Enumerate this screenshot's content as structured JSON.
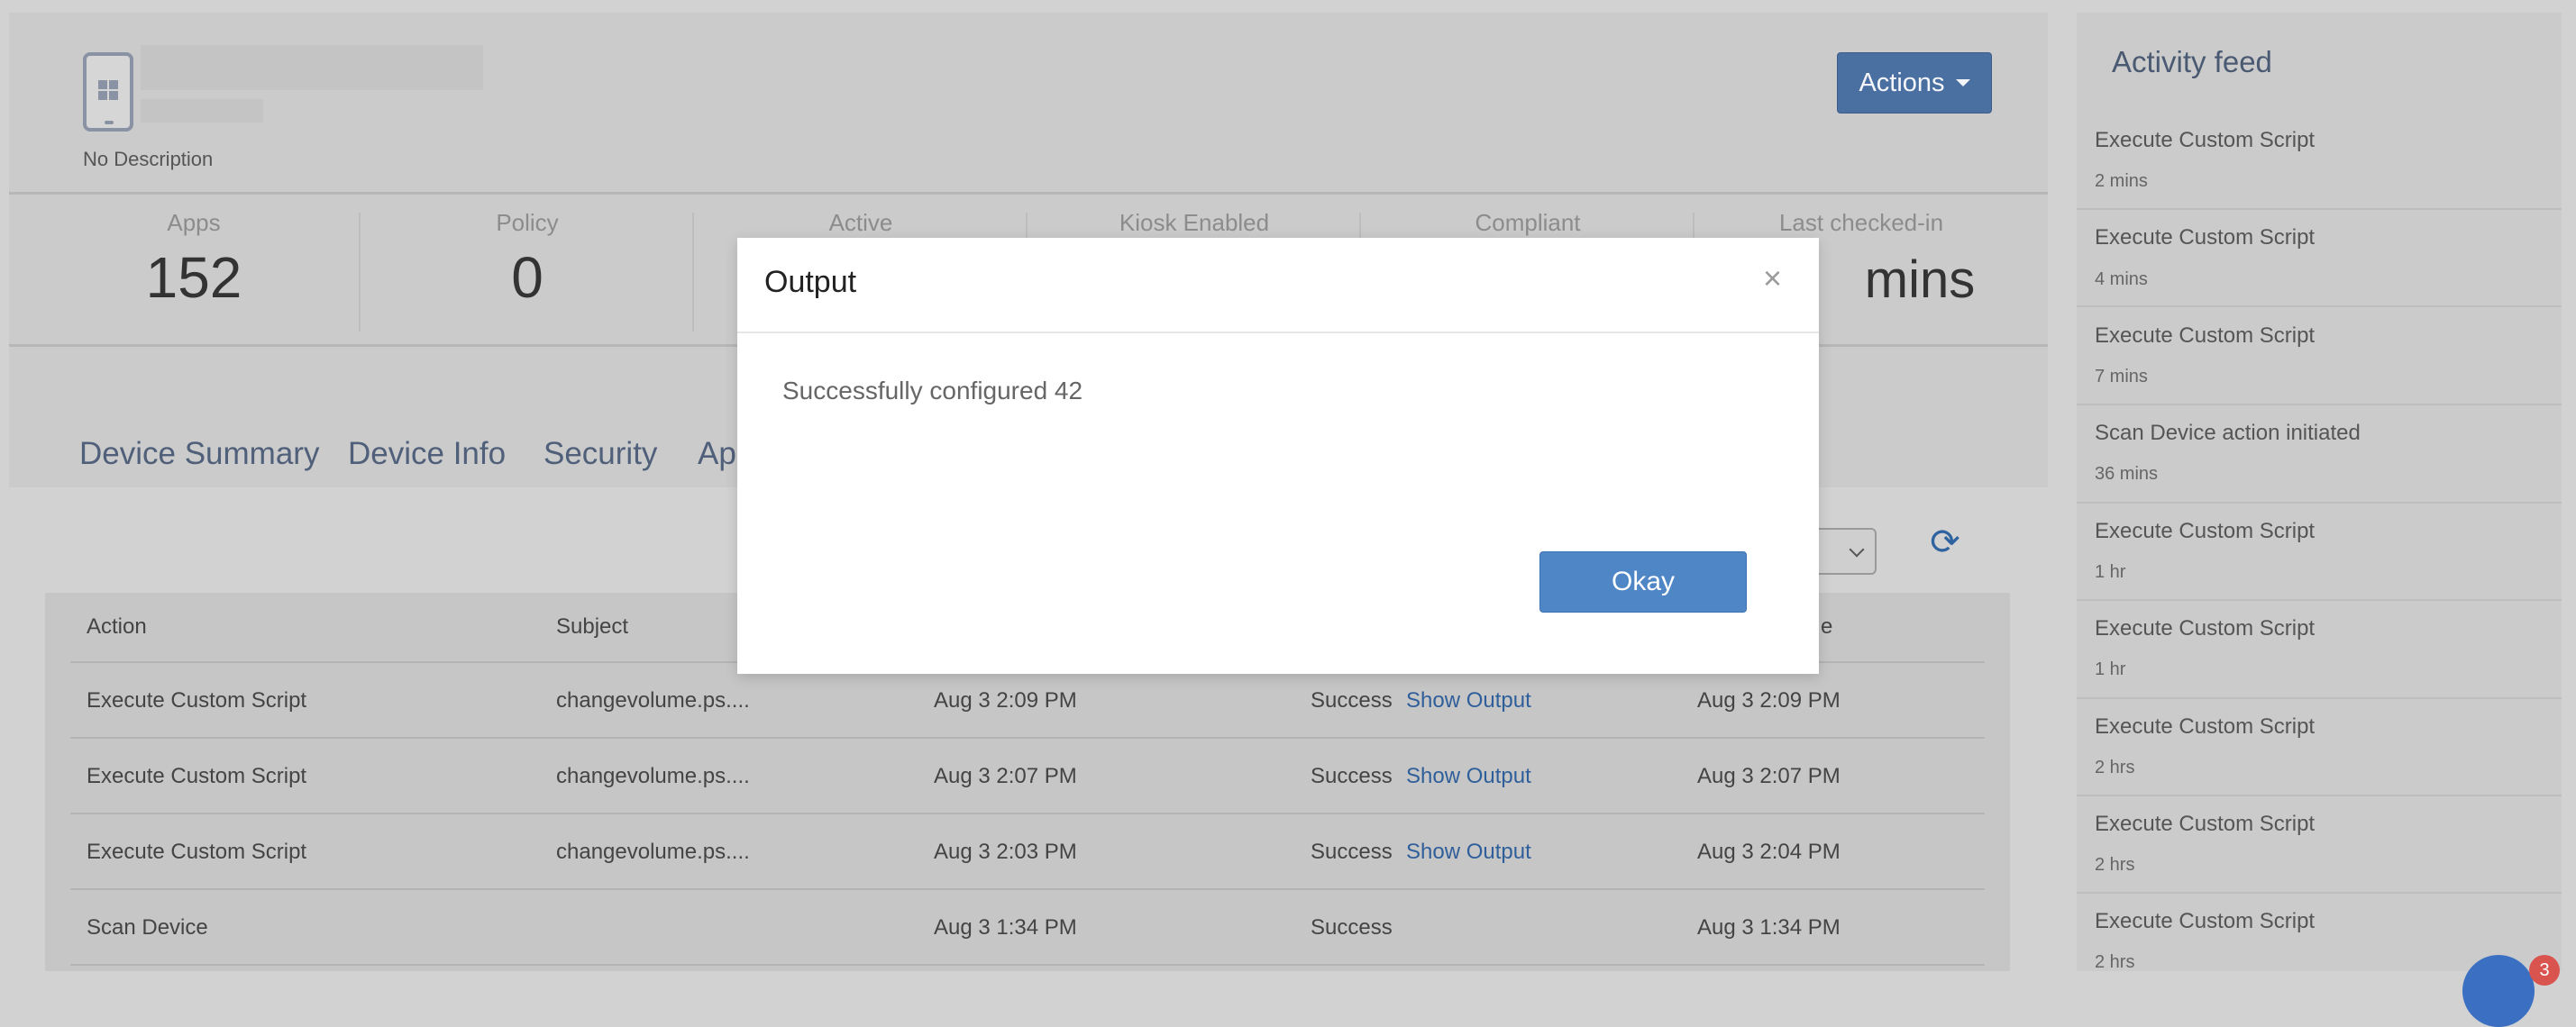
{
  "device": {
    "description": "No Description"
  },
  "header": {
    "actions_label": "Actions"
  },
  "stats": [
    {
      "label": "Apps",
      "value": "152"
    },
    {
      "label": "Policy",
      "value": "0"
    },
    {
      "label": "Active",
      "value": ""
    },
    {
      "label": "Kiosk Enabled",
      "value": ""
    },
    {
      "label": "Compliant",
      "value": ""
    },
    {
      "label": "Last checked-in",
      "value": "mins"
    }
  ],
  "tabs": [
    "Device Summary",
    "Device Info",
    "Security",
    "Ap"
  ],
  "table": {
    "headers": {
      "action": "Action",
      "subject": "Subject",
      "last_col": "e"
    },
    "rows": [
      {
        "action": "Execute Custom Script",
        "subject": "changevolume.ps....",
        "started": "Aug 3 2:09 PM",
        "status": "Success",
        "output": "Show Output",
        "completed": "Aug 3 2:09 PM"
      },
      {
        "action": "Execute Custom Script",
        "subject": "changevolume.ps....",
        "started": "Aug 3 2:07 PM",
        "status": "Success",
        "output": "Show Output",
        "completed": "Aug 3 2:07 PM"
      },
      {
        "action": "Execute Custom Script",
        "subject": "changevolume.ps....",
        "started": "Aug 3 2:03 PM",
        "status": "Success",
        "output": "Show Output",
        "completed": "Aug 3 2:04 PM"
      },
      {
        "action": "Scan Device",
        "subject": "",
        "started": "Aug 3 1:34 PM",
        "status": "Success",
        "output": "",
        "completed": "Aug 3 1:34 PM"
      }
    ]
  },
  "feed": {
    "title": "Activity feed",
    "items": [
      {
        "title": "Execute Custom Script",
        "time": "2 mins"
      },
      {
        "title": "Execute Custom Script",
        "time": "4 mins"
      },
      {
        "title": "Execute Custom Script",
        "time": "7 mins"
      },
      {
        "title": "Scan Device action initiated",
        "time": "36 mins"
      },
      {
        "title": "Execute Custom Script",
        "time": "1 hr"
      },
      {
        "title": "Execute Custom Script",
        "time": "1 hr"
      },
      {
        "title": "Execute Custom Script",
        "time": "2 hrs"
      },
      {
        "title": "Execute Custom Script",
        "time": "2 hrs"
      },
      {
        "title": "Execute Custom Script",
        "time": "2 hrs"
      }
    ]
  },
  "chat": {
    "badge": "3"
  },
  "modal": {
    "title": "Output",
    "close": "×",
    "message": "Successfully configured 42",
    "okay_label": "Okay"
  },
  "icons": {
    "refresh": "⟳"
  },
  "colors": {
    "accent": "#4a6fa1",
    "okay": "#4f86c6",
    "link": "#2f5f9a"
  }
}
